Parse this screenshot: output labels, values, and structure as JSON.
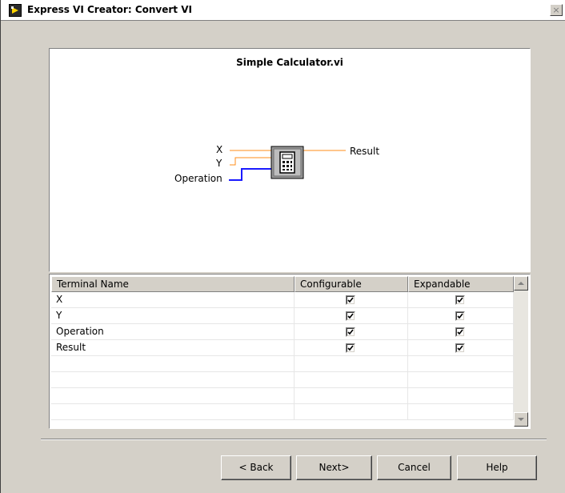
{
  "window": {
    "title": "Express VI Creator: Convert VI",
    "close_label": "×"
  },
  "preview": {
    "vi_name": "Simple Calculator.vi",
    "terminals": {
      "x": "X",
      "y": "Y",
      "operation": "Operation",
      "result": "Result"
    },
    "wire_colors": {
      "numeric": "#ff8c1a",
      "enum": "#1a1aff"
    },
    "icon": "calculator-icon"
  },
  "table": {
    "headers": [
      "Terminal Name",
      "Configurable",
      "Expandable"
    ],
    "rows": [
      {
        "name": "X",
        "configurable": true,
        "expandable": true
      },
      {
        "name": "Y",
        "configurable": true,
        "expandable": true
      },
      {
        "name": "Operation",
        "configurable": true,
        "expandable": true
      },
      {
        "name": "Result",
        "configurable": true,
        "expandable": true
      },
      {
        "name": "",
        "configurable": null,
        "expandable": null
      },
      {
        "name": "",
        "configurable": null,
        "expandable": null
      },
      {
        "name": "",
        "configurable": null,
        "expandable": null
      },
      {
        "name": "",
        "configurable": null,
        "expandable": null
      }
    ]
  },
  "buttons": {
    "back": "< Back",
    "next": "Next>",
    "cancel": "Cancel",
    "help": "Help"
  }
}
